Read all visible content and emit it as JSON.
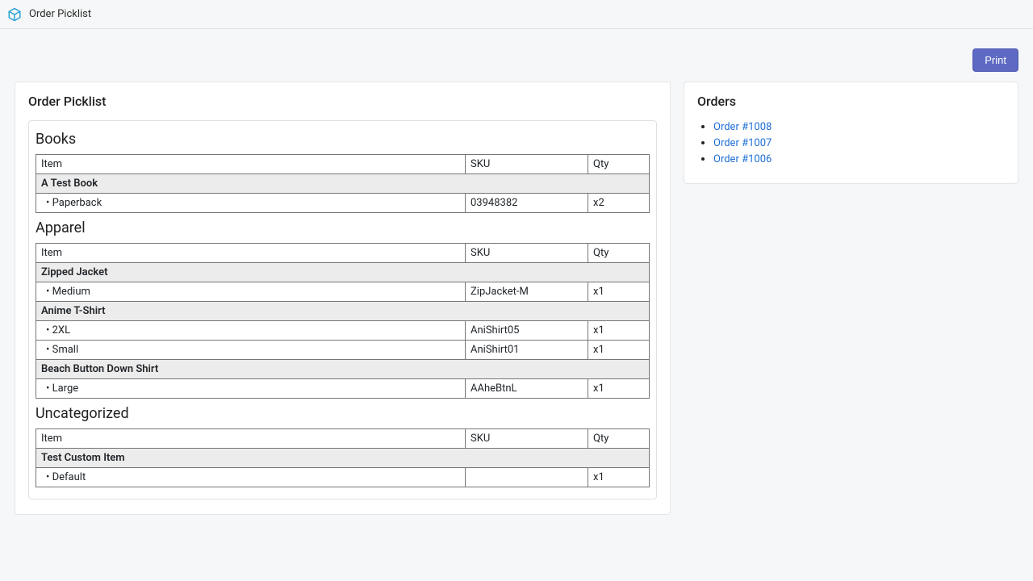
{
  "header": {
    "app_title": "Order Picklist"
  },
  "actions": {
    "print_label": "Print"
  },
  "main": {
    "title": "Order Picklist",
    "columns": {
      "item": "Item",
      "sku": "SKU",
      "qty": "Qty"
    },
    "categories": [
      {
        "name": "Books",
        "products": [
          {
            "name": "A Test Book",
            "variants": [
              {
                "name": "Paperback",
                "sku": "03948382",
                "qty": "x2"
              }
            ]
          }
        ]
      },
      {
        "name": "Apparel",
        "products": [
          {
            "name": "Zipped Jacket",
            "variants": [
              {
                "name": "Medium",
                "sku": "ZipJacket-M",
                "qty": "x1"
              }
            ]
          },
          {
            "name": "Anime T-Shirt",
            "variants": [
              {
                "name": "2XL",
                "sku": "AniShirt05",
                "qty": "x1"
              },
              {
                "name": "Small",
                "sku": "AniShirt01",
                "qty": "x1"
              }
            ]
          },
          {
            "name": "Beach Button Down Shirt",
            "variants": [
              {
                "name": "Large",
                "sku": "AAheBtnL",
                "qty": "x1"
              }
            ]
          }
        ]
      },
      {
        "name": "Uncategorized",
        "products": [
          {
            "name": "Test Custom Item",
            "variants": [
              {
                "name": "Default",
                "sku": "",
                "qty": "x1"
              }
            ]
          }
        ]
      }
    ]
  },
  "side": {
    "title": "Orders",
    "orders": [
      {
        "label": "Order #1008"
      },
      {
        "label": "Order #1007"
      },
      {
        "label": "Order #1006"
      }
    ]
  }
}
